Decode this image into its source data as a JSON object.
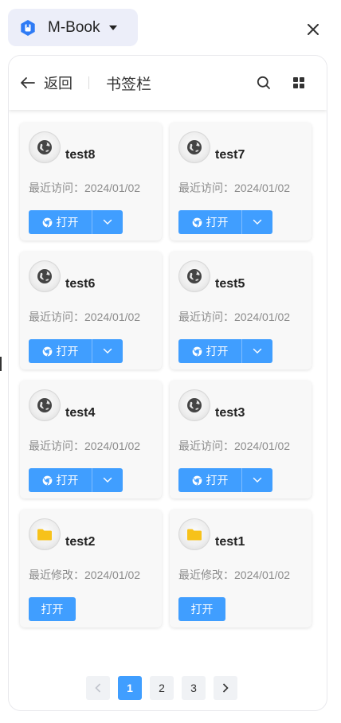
{
  "app": {
    "name": "M-Book"
  },
  "header": {
    "back_label": "返回",
    "title": "书签栏"
  },
  "cards": [
    {
      "name": "test8",
      "meta": "最近访问：2024/01/02",
      "kind": "bookmark",
      "icon": "globe-icon",
      "open_label": "打开"
    },
    {
      "name": "test7",
      "meta": "最近访问：2024/01/02",
      "kind": "bookmark",
      "icon": "globe-icon",
      "open_label": "打开"
    },
    {
      "name": "test6",
      "meta": "最近访问：2024/01/02",
      "kind": "bookmark",
      "icon": "globe-icon",
      "open_label": "打开"
    },
    {
      "name": "test5",
      "meta": "最近访问：2024/01/02",
      "kind": "bookmark",
      "icon": "globe-icon",
      "open_label": "打开"
    },
    {
      "name": "test4",
      "meta": "最近访问：2024/01/02",
      "kind": "bookmark",
      "icon": "globe-icon",
      "open_label": "打开"
    },
    {
      "name": "test3",
      "meta": "最近访问：2024/01/02",
      "kind": "bookmark",
      "icon": "globe-icon",
      "open_label": "打开"
    },
    {
      "name": "test2",
      "meta": "最近修改：2024/01/02",
      "kind": "folder",
      "icon": "folder-icon",
      "open_label": "打开"
    },
    {
      "name": "test1",
      "meta": "最近修改：2024/01/02",
      "kind": "folder",
      "icon": "folder-icon",
      "open_label": "打开"
    }
  ],
  "pagination": {
    "pages": [
      "1",
      "2",
      "3"
    ],
    "current": "1"
  },
  "colors": {
    "accent": "#409eff",
    "folder": "#f7c21a",
    "logo": "#2f7bf5"
  }
}
